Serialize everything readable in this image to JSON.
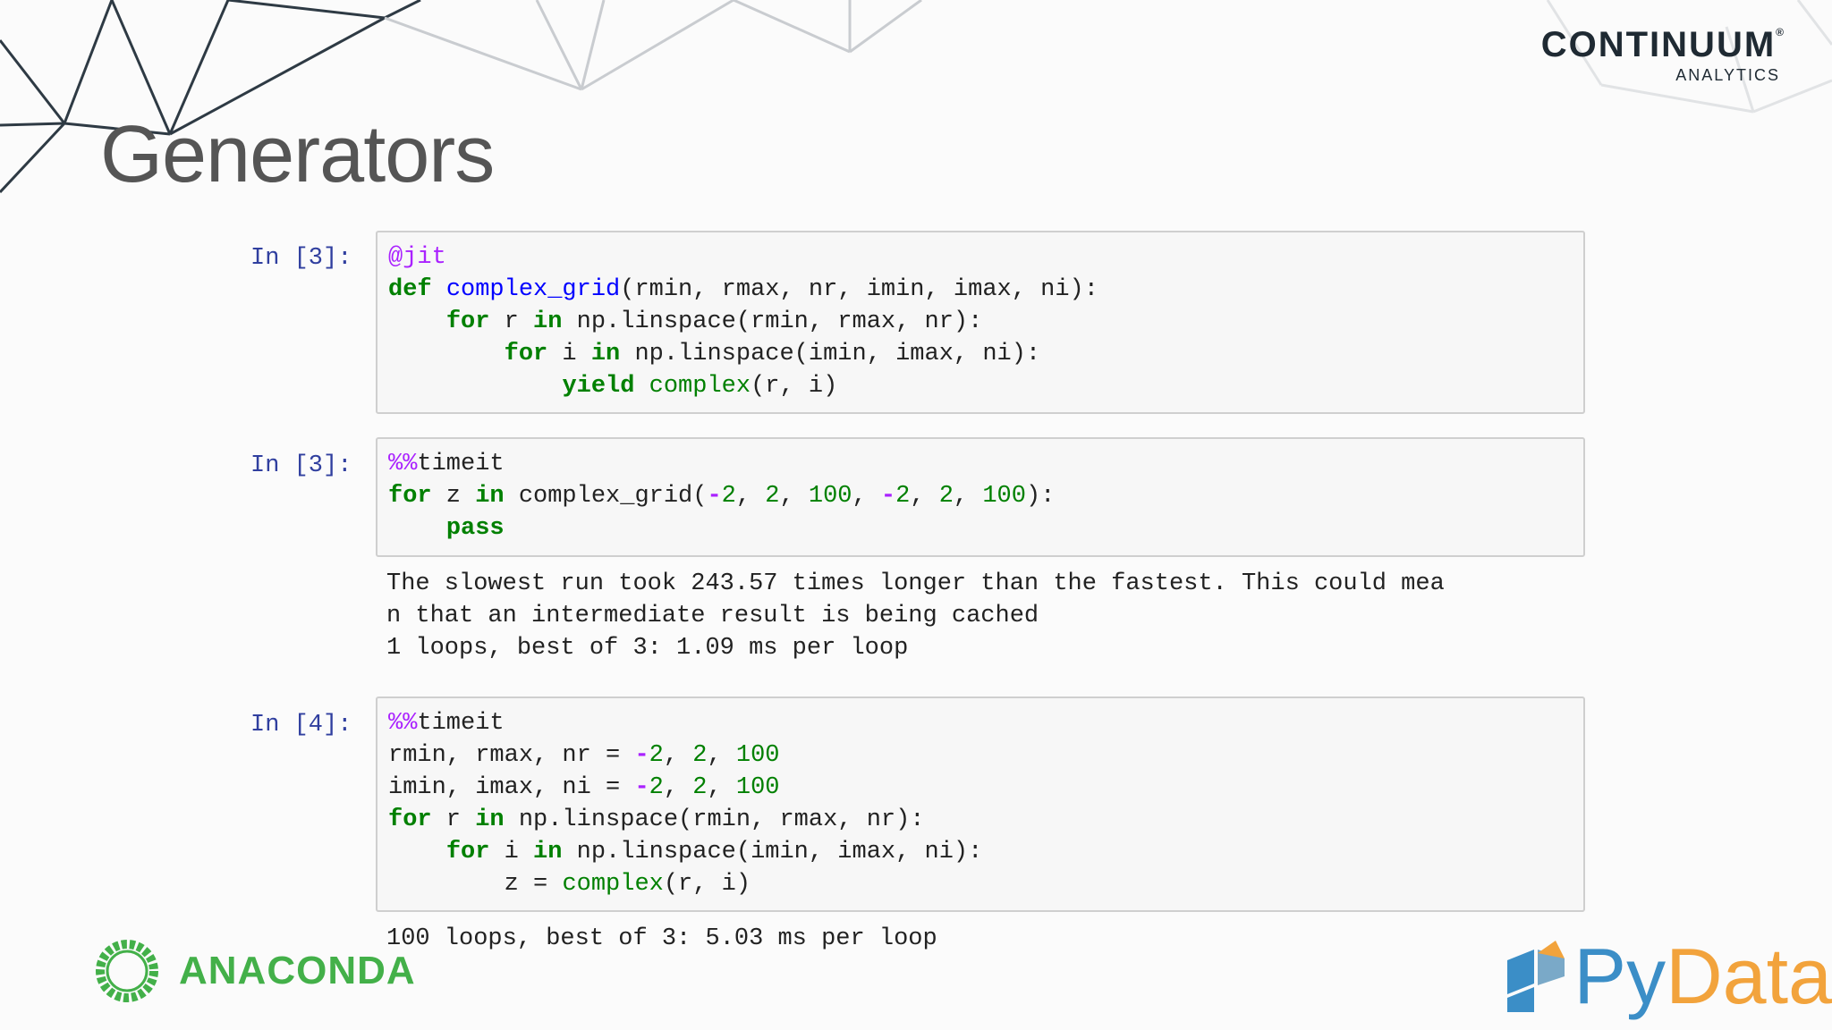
{
  "slide": {
    "title": "Generators"
  },
  "brand": {
    "name": "CONTINUUM",
    "trademark": "®",
    "sub": "ANALYTICS"
  },
  "cells": [
    {
      "prompt": "In [3]:",
      "lines": [
        [
          {
            "t": "@jit",
            "c": "dec"
          }
        ],
        [
          {
            "t": "def",
            "c": "kw"
          },
          {
            "t": " "
          },
          {
            "t": "complex_grid",
            "c": "fn"
          },
          {
            "t": "(rmin, rmax, nr, imin, imax, ni):"
          }
        ],
        [
          {
            "t": "    "
          },
          {
            "t": "for",
            "c": "kw"
          },
          {
            "t": " r "
          },
          {
            "t": "in",
            "c": "kw"
          },
          {
            "t": " np.linspace(rmin, rmax, nr):"
          }
        ],
        [
          {
            "t": "        "
          },
          {
            "t": "for",
            "c": "kw"
          },
          {
            "t": " i "
          },
          {
            "t": "in",
            "c": "kw"
          },
          {
            "t": " np.linspace(imin, imax, ni):"
          }
        ],
        [
          {
            "t": "            "
          },
          {
            "t": "yield",
            "c": "kw"
          },
          {
            "t": " "
          },
          {
            "t": "complex",
            "c": "bi"
          },
          {
            "t": "(r, i)"
          }
        ]
      ]
    },
    {
      "prompt": "In [3]:",
      "lines": [
        [
          {
            "t": "%%",
            "c": "dec"
          },
          {
            "t": "timeit"
          }
        ],
        [
          {
            "t": "for",
            "c": "kw"
          },
          {
            "t": " z "
          },
          {
            "t": "in",
            "c": "kw"
          },
          {
            "t": " complex_grid("
          },
          {
            "t": "-",
            "c": "op"
          },
          {
            "t": "2",
            "c": "num"
          },
          {
            "t": ", "
          },
          {
            "t": "2",
            "c": "num"
          },
          {
            "t": ", "
          },
          {
            "t": "100",
            "c": "num"
          },
          {
            "t": ", "
          },
          {
            "t": "-",
            "c": "op"
          },
          {
            "t": "2",
            "c": "num"
          },
          {
            "t": ", "
          },
          {
            "t": "2",
            "c": "num"
          },
          {
            "t": ", "
          },
          {
            "t": "100",
            "c": "num"
          },
          {
            "t": "):"
          }
        ],
        [
          {
            "t": "    "
          },
          {
            "t": "pass",
            "c": "kw"
          }
        ]
      ],
      "output": [
        "The slowest run took 243.57 times longer than the fastest. This could mea",
        "n that an intermediate result is being cached",
        "1 loops, best of 3: 1.09 ms per loop"
      ]
    },
    {
      "prompt": "In [4]:",
      "lines": [
        [
          {
            "t": "%%",
            "c": "dec"
          },
          {
            "t": "timeit"
          }
        ],
        [
          {
            "t": "rmin, rmax, nr = "
          },
          {
            "t": "-",
            "c": "op"
          },
          {
            "t": "2",
            "c": "num"
          },
          {
            "t": ", "
          },
          {
            "t": "2",
            "c": "num"
          },
          {
            "t": ", "
          },
          {
            "t": "100",
            "c": "num"
          }
        ],
        [
          {
            "t": "imin, imax, ni = "
          },
          {
            "t": "-",
            "c": "op"
          },
          {
            "t": "2",
            "c": "num"
          },
          {
            "t": ", "
          },
          {
            "t": "2",
            "c": "num"
          },
          {
            "t": ", "
          },
          {
            "t": "100",
            "c": "num"
          }
        ],
        [
          {
            "t": "for",
            "c": "kw"
          },
          {
            "t": " r "
          },
          {
            "t": "in",
            "c": "kw"
          },
          {
            "t": " np.linspace(rmin, rmax, nr):"
          }
        ],
        [
          {
            "t": "    "
          },
          {
            "t": "for",
            "c": "kw"
          },
          {
            "t": " i "
          },
          {
            "t": "in",
            "c": "kw"
          },
          {
            "t": " np.linspace(imin, imax, ni):"
          }
        ],
        [
          {
            "t": "        z = "
          },
          {
            "t": "complex",
            "c": "bi"
          },
          {
            "t": "(r, i)"
          }
        ]
      ],
      "output": [
        "100 loops, best of 3: 5.03 ms per loop"
      ]
    }
  ],
  "footer": {
    "anaconda": "ANACONDA",
    "pydata_py": "Py",
    "pydata_data": "Data"
  },
  "colors": {
    "keyword": "#008000",
    "function": "#0000ff",
    "magic": "#aa22ff",
    "prompt": "#303f9f",
    "anaconda": "#43b049",
    "py": "#3b8ec7",
    "data": "#f2a33c"
  }
}
